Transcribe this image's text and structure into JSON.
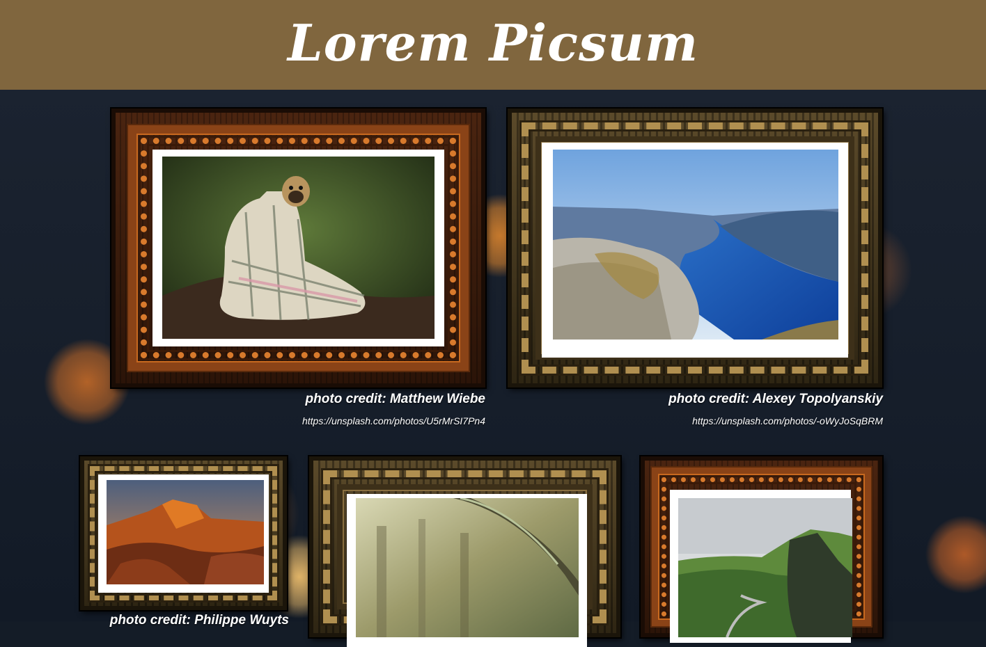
{
  "header": {
    "title": "Lorem Picsum",
    "bg_color": "#80663e"
  },
  "gallery": [
    {
      "frame_style": "copper",
      "subject": "pug in blanket",
      "credit": "photo credit: Matthew Wiebe",
      "url": "https://unsplash.com/photos/U5rMrSI7Pn4"
    },
    {
      "frame_style": "bronze",
      "subject": "fjord landscape",
      "credit": "photo credit: Alexey Topolyanskiy",
      "url": "https://unsplash.com/photos/-oWyJoSqBRM"
    },
    {
      "frame_style": "bronze",
      "subject": "red rock canyon sunset",
      "credit": "photo credit: Philippe Wuyts",
      "url": ""
    },
    {
      "frame_style": "bronze",
      "subject": "forest branch",
      "credit": "",
      "url": ""
    },
    {
      "frame_style": "copper",
      "subject": "green mountain road",
      "credit": "",
      "url": ""
    }
  ]
}
